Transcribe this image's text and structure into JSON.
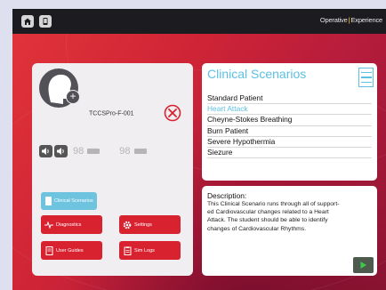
{
  "brand": {
    "name_left": "Operative",
    "name_right": "Experience"
  },
  "device": {
    "id": "TCCSPro-F-001"
  },
  "meters": {
    "speaker1_value": "98",
    "speaker2_value": "98"
  },
  "buttons": {
    "clinical_scenarios": "Clinical Scenarios",
    "diagnostics": "Diagnostics",
    "settings": "Settings",
    "user_guides": "User Guides",
    "sim_logs": "Sim Logs"
  },
  "scenarios": {
    "title": "Clinical Scenarios",
    "items": [
      {
        "label": "Standard Patient"
      },
      {
        "label": "Heart Attack"
      },
      {
        "label": "Cheyne-Stokes Breathing"
      },
      {
        "label": "Burn Patient"
      },
      {
        "label": "Severe Hypothermia"
      },
      {
        "label": "Siezure"
      }
    ],
    "selected_index": 1
  },
  "description": {
    "title": "Description:",
    "lines": [
      "This Clinical Scenario runs through all of support-",
      "ed Cardiovascular changes related to a Heart",
      "Attack. The student should be able to identify",
      "changes of Cardiovascular Rhythms."
    ]
  },
  "colors": {
    "accent": "#5cc0e3",
    "red_button": "#d82230",
    "panel": "#f1eef2",
    "background_red": "#cf2436"
  }
}
